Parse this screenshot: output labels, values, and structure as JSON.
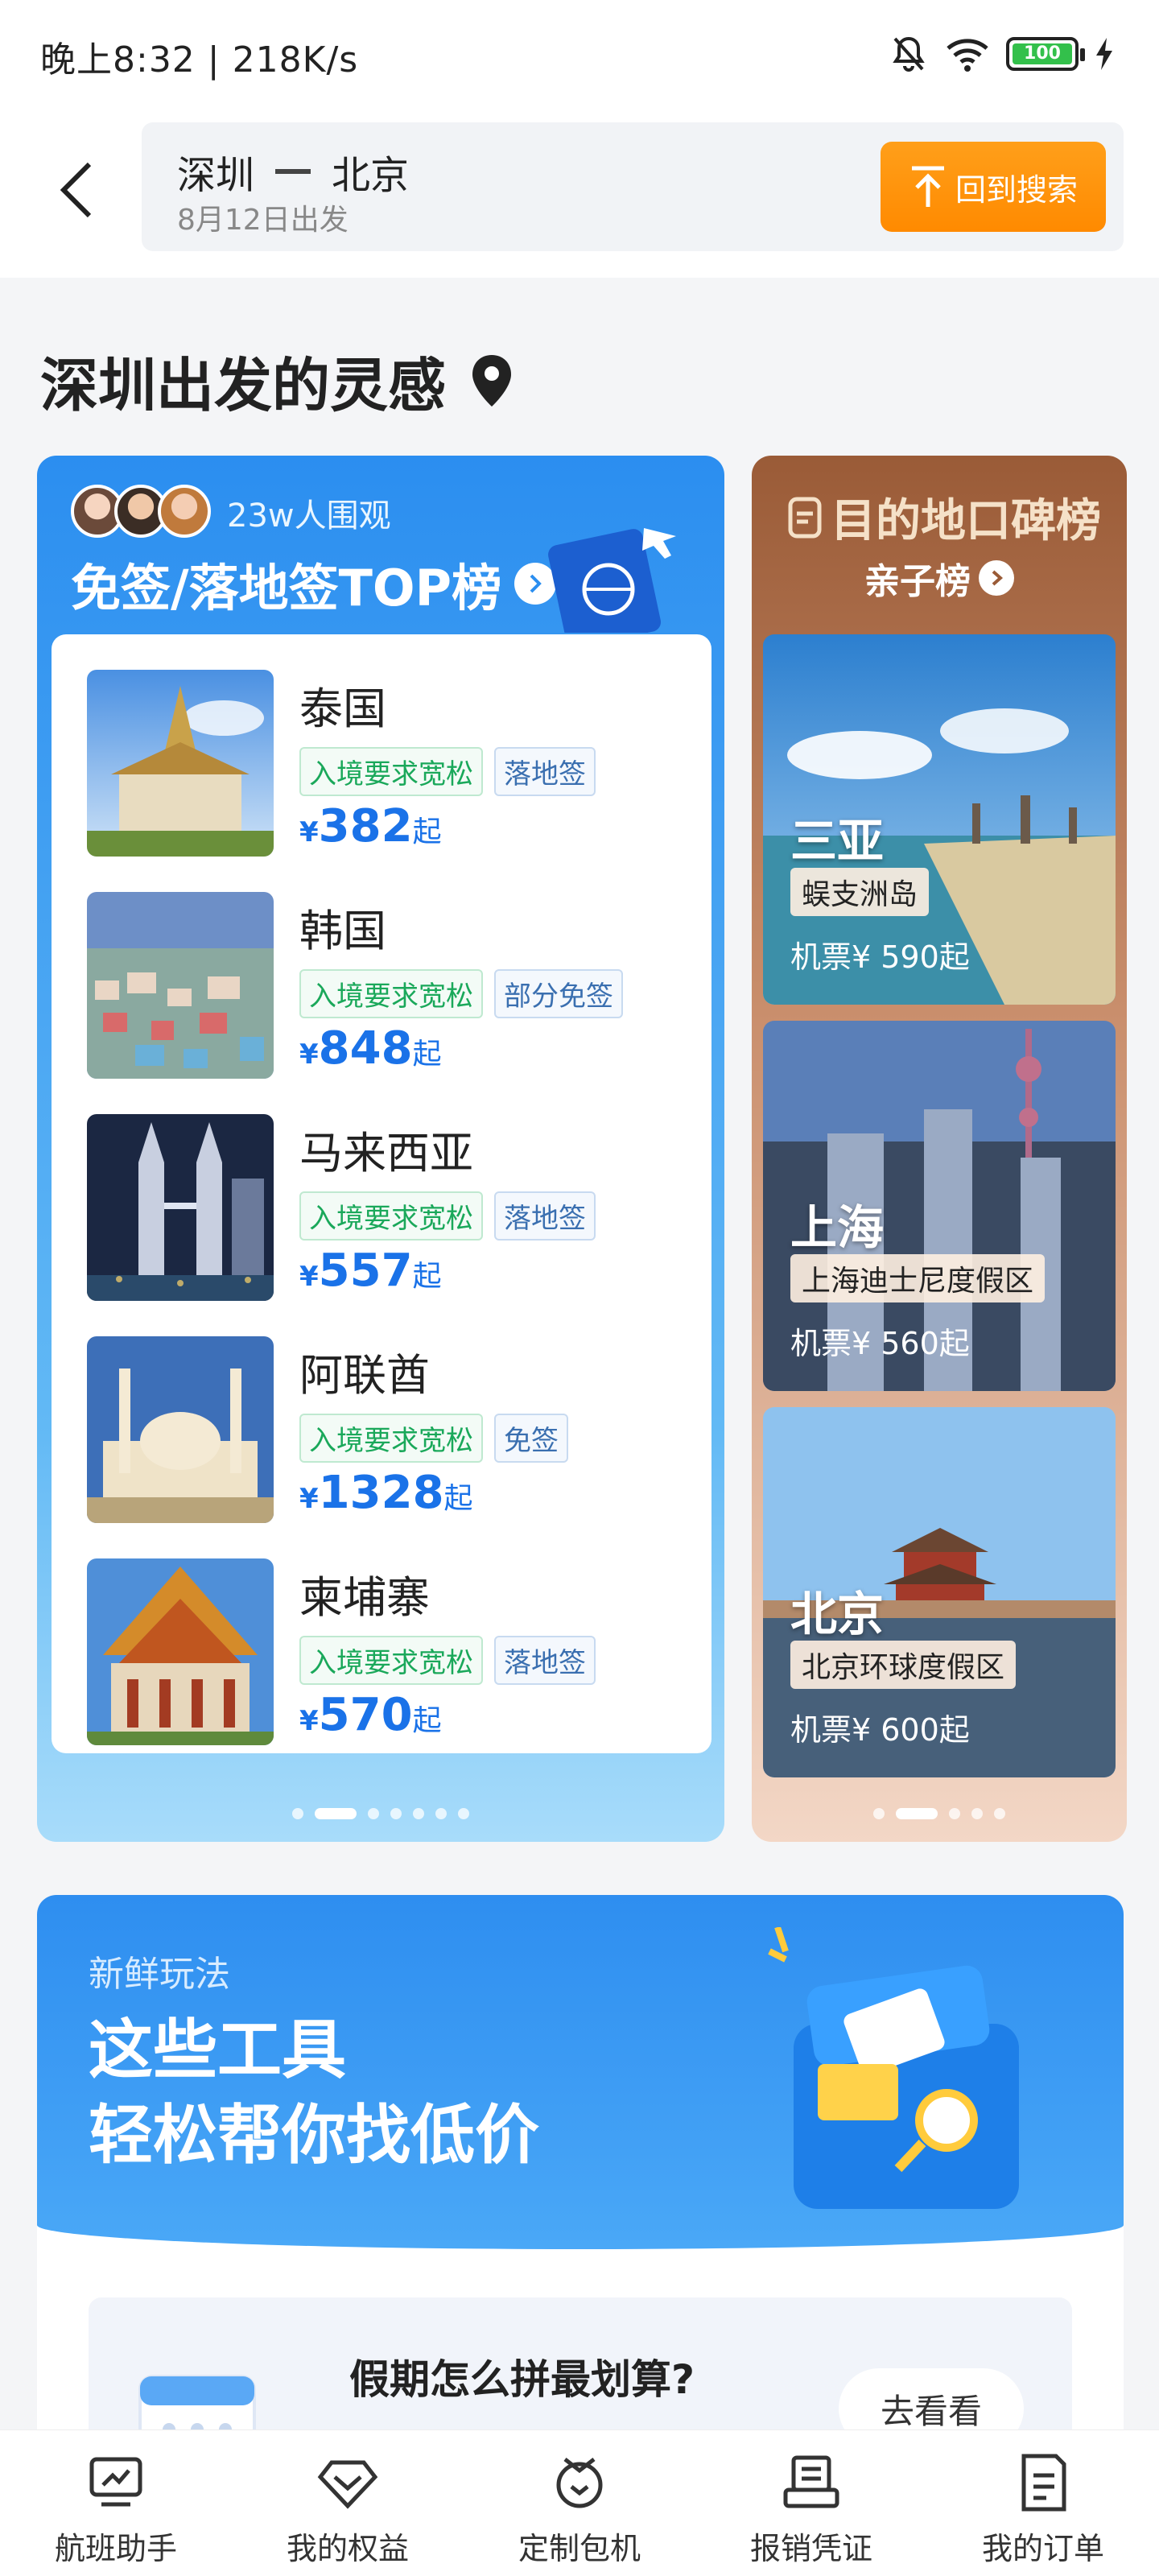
{
  "status": {
    "time_speed": "晚上8:32 | 218K/s",
    "battery": "100"
  },
  "header": {
    "from": "深圳",
    "to": "北京",
    "date": "8月12日出发",
    "back_search_label": "回到搜索"
  },
  "section": {
    "title": "深圳出发的灵感"
  },
  "visa_card": {
    "viewers": "23w人围观",
    "title": "免签/落地签TOP榜",
    "items": [
      {
        "name": "泰国",
        "tag1": "入境要求宽松",
        "tag2": "落地签",
        "yen": "¥",
        "price": "382",
        "suffix": "起"
      },
      {
        "name": "韩国",
        "tag1": "入境要求宽松",
        "tag2": "部分免签",
        "yen": "¥",
        "price": "848",
        "suffix": "起"
      },
      {
        "name": "马来西亚",
        "tag1": "入境要求宽松",
        "tag2": "落地签",
        "yen": "¥",
        "price": "557",
        "suffix": "起"
      },
      {
        "name": "阿联酋",
        "tag1": "入境要求宽松",
        "tag2": "免签",
        "yen": "¥",
        "price": "1328",
        "suffix": "起"
      },
      {
        "name": "柬埔寨",
        "tag1": "入境要求宽松",
        "tag2": "落地签",
        "yen": "¥",
        "price": "570",
        "suffix": "起"
      }
    ]
  },
  "dest_card": {
    "logo": "目的地口碑榜",
    "subtitle": "亲子榜",
    "tiles": [
      {
        "city": "三亚",
        "spot": "蜈支洲岛",
        "price": "机票¥ 590起"
      },
      {
        "city": "上海",
        "spot": "上海迪士尼度假区",
        "price": "机票¥ 560起"
      },
      {
        "city": "北京",
        "spot": "北京环球度假区",
        "price": "机票¥ 600起"
      }
    ]
  },
  "tools": {
    "kicker": "新鲜玩法",
    "title_line1": "这些工具",
    "title_line2": "轻松帮你找低价",
    "holiday_text": "假期怎么拼最划算?",
    "see_label": "去看看"
  },
  "bottom_nav": [
    {
      "label": "航班助手",
      "icon": "flight-assistant-icon"
    },
    {
      "label": "我的权益",
      "icon": "diamond-icon"
    },
    {
      "label": "定制包机",
      "icon": "charter-icon"
    },
    {
      "label": "报销凭证",
      "icon": "receipt-icon"
    },
    {
      "label": "我的订单",
      "icon": "order-icon"
    }
  ],
  "colors": {
    "accent_orange": "#ff8a00",
    "visa_blue": "#2b8ef0",
    "price_blue": "#1a72e8",
    "tag_green": "#1aa85a"
  }
}
